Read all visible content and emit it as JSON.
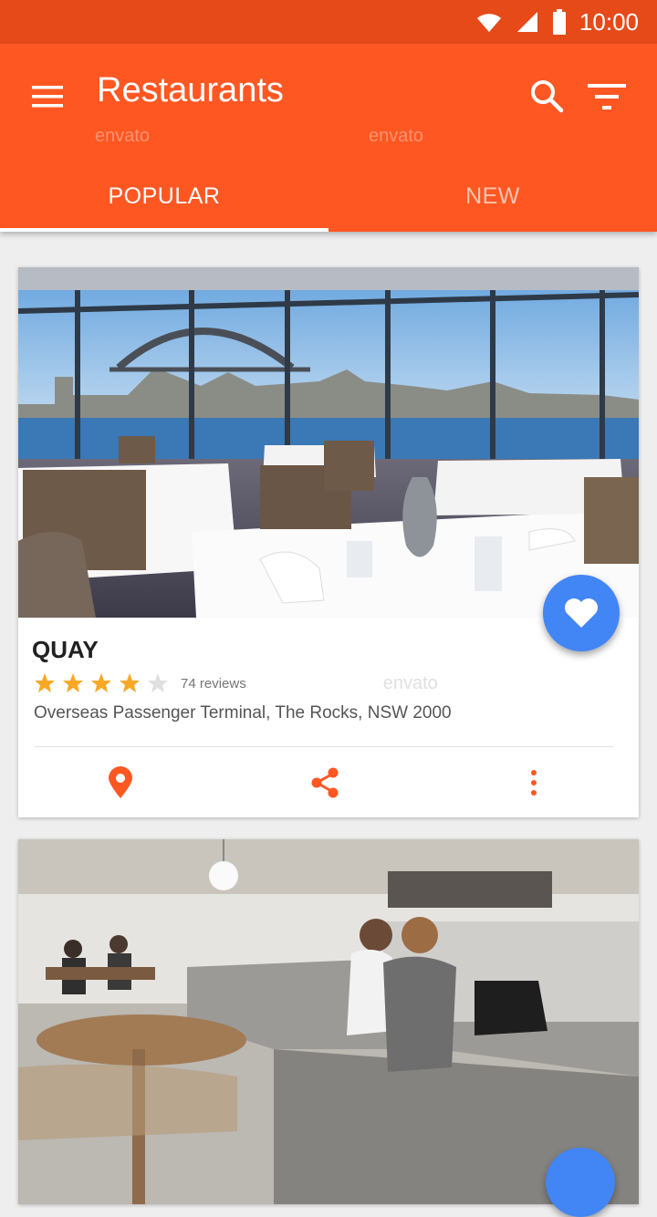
{
  "status_bar": {
    "time": "10:00"
  },
  "app_bar": {
    "title": "Restaurants",
    "watermark": "envato"
  },
  "tabs": [
    {
      "label": "POPULAR"
    },
    {
      "label": "NEW"
    }
  ],
  "restaurants": [
    {
      "name": "QUAY",
      "rating": 4,
      "rating_max": 5,
      "reviews": "74 reviews",
      "address": "Overseas Passenger Terminal, The Rocks, NSW 2000"
    }
  ],
  "colors": {
    "primary": "#ff5722",
    "primary_dark": "#e64a19",
    "accent": "#4285f4",
    "star": "#f9a825"
  },
  "icons": [
    "menu-icon",
    "search-icon",
    "filter-icon",
    "heart-icon",
    "location-pin-icon",
    "share-icon",
    "more-vert-icon",
    "wifi-icon",
    "signal-icon",
    "battery-icon"
  ]
}
